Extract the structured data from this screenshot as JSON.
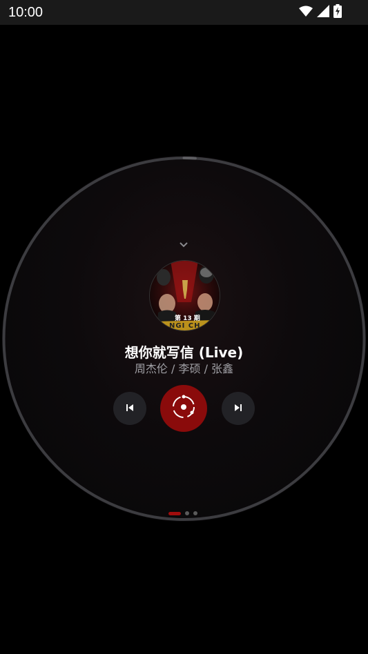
{
  "status_bar": {
    "time": "10:00",
    "icons": [
      "wifi-icon",
      "cell-signal-icon",
      "battery-charging-icon"
    ]
  },
  "player": {
    "title": "想你就写信 (Live)",
    "artist": "周杰伦 / 李硕 / 张鑫",
    "album_badge": "第 13 期",
    "album_banner": "NGI CH",
    "progress": 0.01
  },
  "controls": {
    "previous": "skip-previous-icon",
    "play": "play-pause-icon",
    "next": "skip-next-icon"
  },
  "pagination": {
    "pages": 3,
    "current": 1
  },
  "colors": {
    "accent": "#8a0b0b",
    "ring": "#3c3c40",
    "background": "#000000",
    "status_bar": "#1a1a1a"
  }
}
